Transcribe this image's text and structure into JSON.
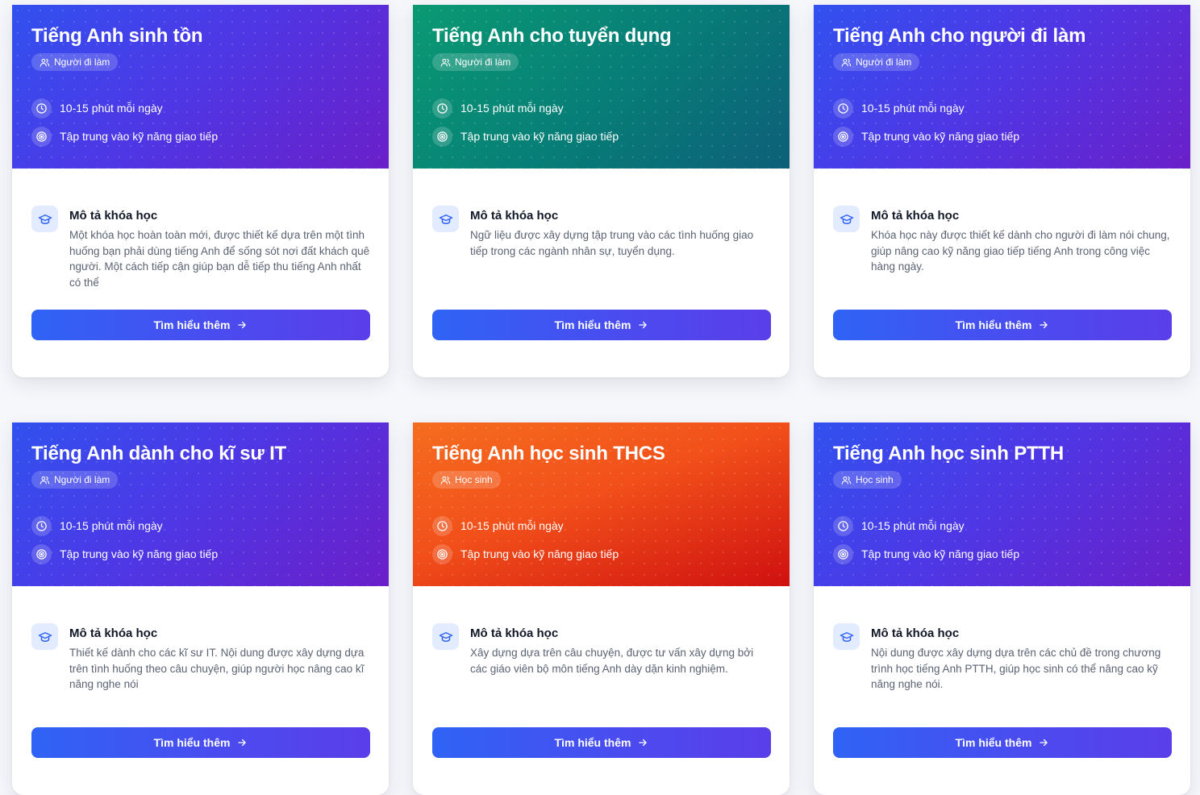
{
  "colors": {
    "blue_gradient": "#3151ef",
    "green_gradient": "#0a9a73",
    "orange_gradient": "#f56d1f",
    "button": "#2f63f5",
    "description_icon_bg": "#e3ecff"
  },
  "icons": {
    "audience": "users-icon",
    "time": "clock-icon",
    "focus": "target-icon",
    "description": "graduation-cap-icon",
    "button": "arrow-right-icon"
  },
  "cards": [
    {
      "title": "Tiếng Anh sinh tồn",
      "audience": "Người đi làm",
      "duration": "10-15 phút mỗi ngày",
      "focus": "Tập trung vào kỹ năng giao tiếp",
      "desc_title": "Mô tả khóa học",
      "desc": "Một khóa học hoàn toàn mới, được thiết kế dựa trên một tình huống bạn phải dùng tiếng Anh để sống sót nơi đất khách quê người. Một cách tiếp cận giúp bạn dễ tiếp thu tiếng Anh nhất có thể",
      "button": "Tìm hiểu thêm"
    },
    {
      "title": "Tiếng Anh cho tuyển dụng",
      "audience": "Người đi làm",
      "duration": "10-15 phút mỗi ngày",
      "focus": "Tập trung vào kỹ năng giao tiếp",
      "desc_title": "Mô tả khóa học",
      "desc": "Ngữ liệu được xây dựng tập trung vào các tình huống giao tiếp trong các ngành nhân sự, tuyển dụng.",
      "button": "Tìm hiểu thêm"
    },
    {
      "title": "Tiếng Anh cho người đi làm",
      "audience": "Người đi làm",
      "duration": "10-15 phút mỗi ngày",
      "focus": "Tập trung vào kỹ năng giao tiếp",
      "desc_title": "Mô tả khóa học",
      "desc": "Khóa học này được thiết kế dành cho người đi làm nói chung, giúp nâng cao kỹ năng giao tiếp tiếng Anh trong công việc hàng ngày.",
      "button": "Tìm hiểu thêm"
    },
    {
      "title": "Tiếng Anh dành cho kĩ sư IT",
      "audience": "Người đi làm",
      "duration": "10-15 phút mỗi ngày",
      "focus": "Tập trung vào kỹ năng giao tiếp",
      "desc_title": "Mô tả khóa học",
      "desc": "Thiết kế dành cho các kĩ sư IT. Nội dung được xây dựng dựa trên tình huống theo câu chuyện, giúp người học nâng cao kĩ năng nghe nói",
      "button": "Tìm hiểu thêm"
    },
    {
      "title": "Tiếng Anh học sinh THCS",
      "audience": "Học sinh",
      "duration": "10-15 phút mỗi ngày",
      "focus": "Tập trung vào kỹ năng giao tiếp",
      "desc_title": "Mô tả khóa học",
      "desc": "Xây dựng dựa trên câu chuyện, được tư vấn xây dựng bởi các giáo viên bộ môn tiếng Anh dày dặn kinh nghiệm.",
      "button": "Tìm hiểu thêm"
    },
    {
      "title": "Tiếng Anh học sinh PTTH",
      "audience": "Học sinh",
      "duration": "10-15 phút mỗi ngày",
      "focus": "Tập trung vào kỹ năng giao tiếp",
      "desc_title": "Mô tả khóa học",
      "desc": "Nội dung được xây dựng dựa trên các chủ đề trong chương trình học tiếng Anh PTTH, giúp học sinh có thể nâng cao kỹ năng nghe nói.",
      "button": "Tìm hiểu thêm"
    }
  ]
}
